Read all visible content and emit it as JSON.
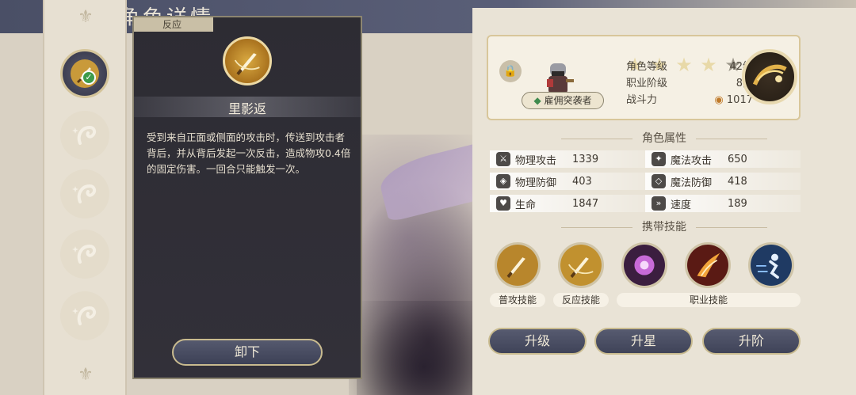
{
  "header": {
    "title": "角色详情"
  },
  "slots": {
    "equipped_check": "✓"
  },
  "detail": {
    "tag": "反应",
    "skill_name": "里影返",
    "description": "受到来自正面或侧面的攻击时，传送到攻击者背后，并从背后发起一次反击，造成物攻0.4倍的固定伤害。一回合只能触发一次。",
    "unequip_label": "卸下"
  },
  "character": {
    "stars_total": 5,
    "stars_filled": 4,
    "level_label": "角色等级",
    "level_value": "42级",
    "rank_label": "职业阶级",
    "rank_value": "8阶",
    "power_label": "战斗力",
    "power_value": "1017",
    "class_name": "雇佣突袭者"
  },
  "attributes": {
    "title": "角色属性",
    "rows": [
      [
        {
          "label": "物理攻击",
          "value": "1339"
        },
        {
          "label": "魔法攻击",
          "value": "650"
        }
      ],
      [
        {
          "label": "物理防御",
          "value": "403"
        },
        {
          "label": "魔法防御",
          "value": "418"
        }
      ],
      [
        {
          "label": "生命",
          "value": "1847"
        },
        {
          "label": "速度",
          "value": "189"
        }
      ]
    ]
  },
  "skills": {
    "title": "携带技能",
    "basic_label": "普攻技能",
    "reaction_label": "反应技能",
    "class_label": "职业技能"
  },
  "actions": {
    "upgrade": "升级",
    "star_up": "升星",
    "rank_up": "升阶"
  }
}
